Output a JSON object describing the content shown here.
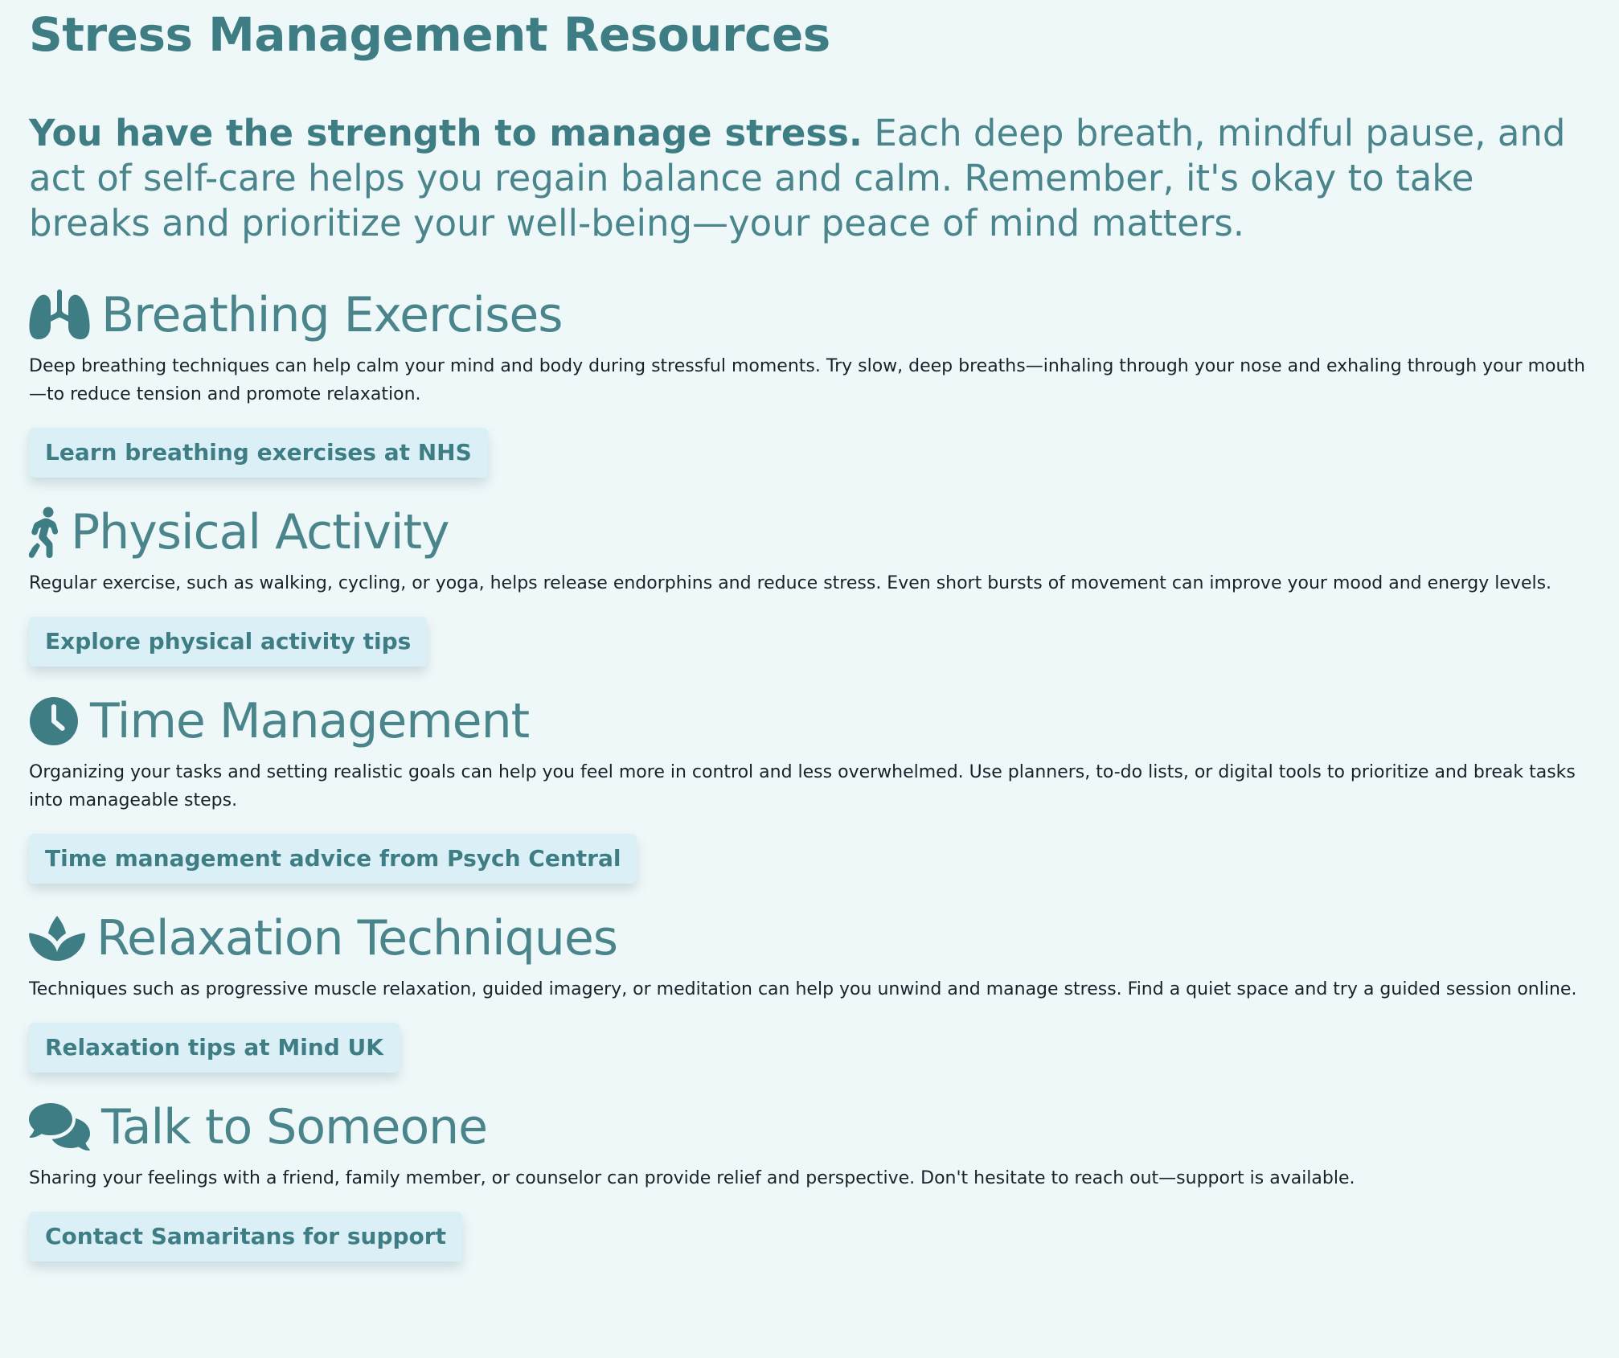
{
  "page_title": "Stress Management Resources",
  "intro": {
    "lead": "You have the strength to manage stress.",
    "text": " Each deep breath, mindful pause, and act of self-care helps you regain balance and calm. Remember, it's okay to take breaks and prioritize your well-being—your peace of mind matters."
  },
  "colors": {
    "accent": "#3f7d85",
    "background": "#eff8f9",
    "button_bg": "#daf0f6",
    "body_text": "#17222b"
  },
  "sections": [
    {
      "icon": "lungs-icon",
      "title": "Breathing Exercises",
      "text": "Deep breathing techniques can help calm your mind and body during stressful moments. Try slow, deep breaths—inhaling through your nose and exhaling through your mouth—to reduce tension and promote relaxation.",
      "link": "Learn breathing exercises at NHS"
    },
    {
      "icon": "person-walking-icon",
      "title": "Physical Activity",
      "text": "Regular exercise, such as walking, cycling, or yoga, helps release endorphins and reduce stress. Even short bursts of movement can improve your mood and energy levels.",
      "link": "Explore physical activity tips"
    },
    {
      "icon": "clock-icon",
      "title": "Time Management",
      "text": "Organizing your tasks and setting realistic goals can help you feel more in control and less overwhelmed. Use planners, to-do lists, or digital tools to prioritize and break tasks into manageable steps.",
      "link": "Time management advice from Psych Central"
    },
    {
      "icon": "lotus-icon",
      "title": "Relaxation Techniques",
      "text": "Techniques such as progressive muscle relaxation, guided imagery, or meditation can help you unwind and manage stress. Find a quiet space and try a guided session online.",
      "link": "Relaxation tips at Mind UK"
    },
    {
      "icon": "comments-icon",
      "title": "Talk to Someone",
      "text": "Sharing your feelings with a friend, family member, or counselor can provide relief and perspective. Don't hesitate to reach out—support is available.",
      "link": "Contact Samaritans for support"
    }
  ]
}
